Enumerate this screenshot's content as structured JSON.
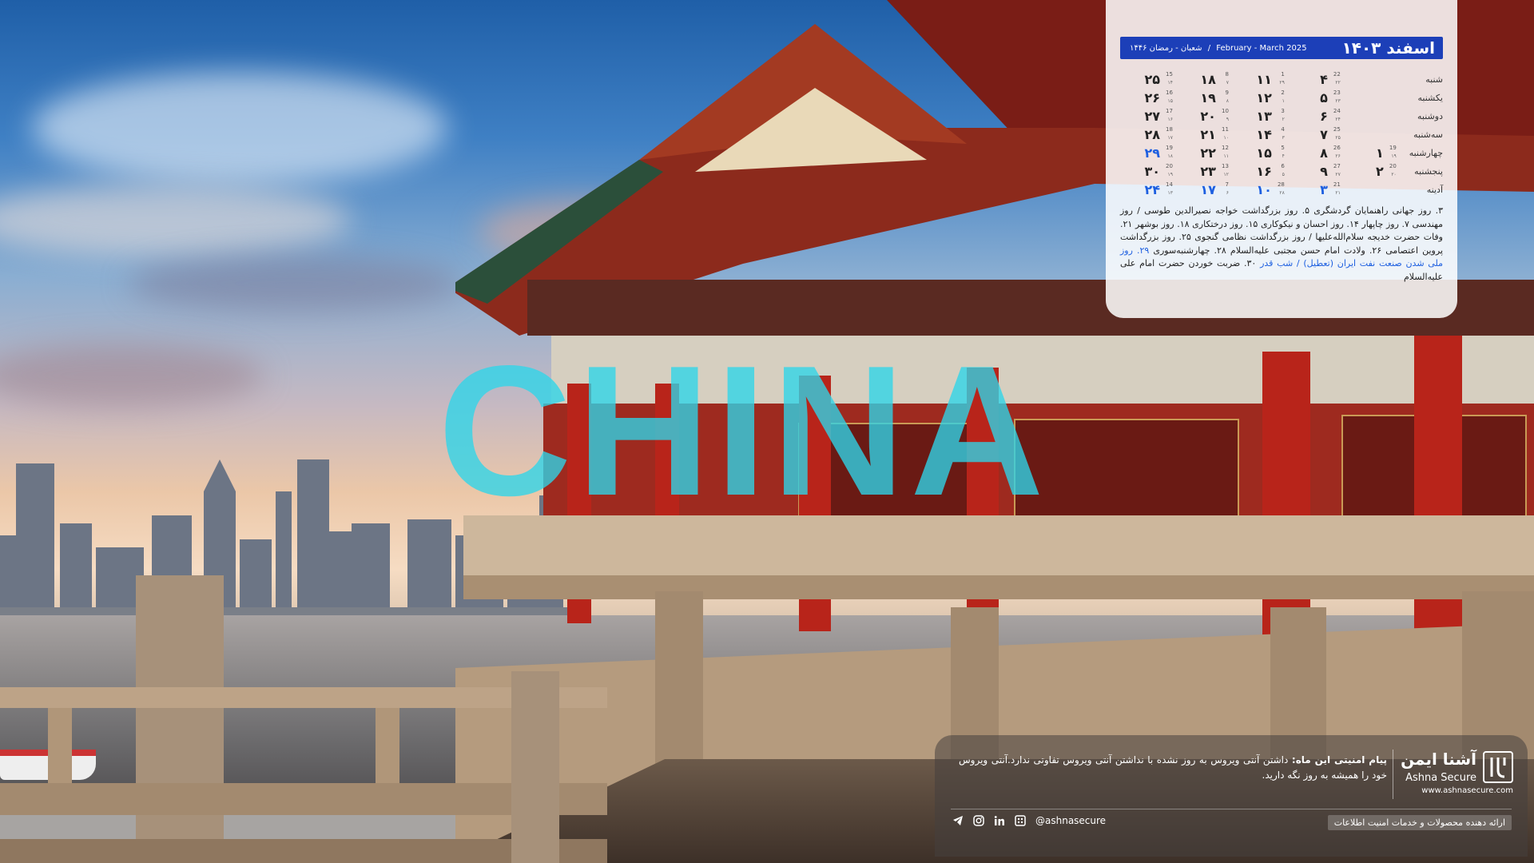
{
  "watermark": "CHINA",
  "calendar": {
    "title": "اسفند ۱۴۰۳",
    "gregorian": "February - March 2025",
    "hijri": "شعبان - رمضان ۱۴۴۶",
    "separator": "/",
    "weekdays": [
      "شنبه",
      "یکشنبه",
      "دوشنبه",
      "سه‌شنبه",
      "چهارشنبه",
      "پنجشنبه",
      "آدینه"
    ],
    "rows": [
      [
        {
          "d": "۴",
          "g": "22",
          "h": "۲۲"
        },
        {
          "d": "۱۱",
          "g": "1",
          "h": "۲۹"
        },
        {
          "d": "۱۸",
          "g": "8",
          "h": "۷"
        },
        {
          "d": "۲۵",
          "g": "15",
          "h": "۱۴"
        }
      ],
      [
        {
          "d": "۵",
          "g": "23",
          "h": "۲۳"
        },
        {
          "d": "۱۲",
          "g": "2",
          "h": "۱"
        },
        {
          "d": "۱۹",
          "g": "9",
          "h": "۸"
        },
        {
          "d": "۲۶",
          "g": "16",
          "h": "۱۵"
        }
      ],
      [
        {
          "d": "۶",
          "g": "24",
          "h": "۲۴"
        },
        {
          "d": "۱۳",
          "g": "3",
          "h": "۲"
        },
        {
          "d": "۲۰",
          "g": "10",
          "h": "۹"
        },
        {
          "d": "۲۷",
          "g": "17",
          "h": "۱۶"
        }
      ],
      [
        {
          "d": "۷",
          "g": "25",
          "h": "۲۵"
        },
        {
          "d": "۱۴",
          "g": "4",
          "h": "۳"
        },
        {
          "d": "۲۱",
          "g": "11",
          "h": "۱۰"
        },
        {
          "d": "۲۸",
          "g": "18",
          "h": "۱۷"
        }
      ],
      [
        {
          "d": "۱",
          "g": "19",
          "h": "۱۹"
        },
        {
          "d": "۸",
          "g": "26",
          "h": "۲۶"
        },
        {
          "d": "۱۵",
          "g": "5",
          "h": "۴"
        },
        {
          "d": "۲۲",
          "g": "12",
          "h": "۱۱"
        },
        {
          "d": "۲۹",
          "g": "19",
          "h": "۱۸",
          "hol": true
        }
      ],
      [
        {
          "d": "۲",
          "g": "20",
          "h": "۲۰"
        },
        {
          "d": "۹",
          "g": "27",
          "h": "۲۷"
        },
        {
          "d": "۱۶",
          "g": "6",
          "h": "۵"
        },
        {
          "d": "۲۳",
          "g": "13",
          "h": "۱۲"
        },
        {
          "d": "۳۰",
          "g": "20",
          "h": "۱۹"
        }
      ],
      [
        {
          "d": "۳",
          "g": "21",
          "h": "۲۱",
          "hol": true
        },
        {
          "d": "۱۰",
          "g": "28",
          "h": "۲۸",
          "hol": true
        },
        {
          "d": "۱۷",
          "g": "7",
          "h": "۶",
          "hol": true
        },
        {
          "d": "۲۴",
          "g": "14",
          "h": "۱۳",
          "hol": true
        }
      ]
    ],
    "events_text": "۳. روز جهانی راهنمایان گردشگری ۵. روز بزرگداشت خواجه نصیرالدین طوسی / روز مهندسی ۷. روز چاپهار ۱۴. روز احسان و نیکوکاری ۱۵. روز درختکاری ۱۸. روز بوشهر ۲۱. وفات حضرت خدیجه سلام‌الله‌علیها / روز بزرگداشت نظامی گنجوی ۲۵. روز بزرگداشت پروین اعتصامی ۲۶. ولادت امام حسن مجتبی علیه‌السلام ۲۸. چهارشنبه‌سوری",
    "events_blue": "۲۹. روز ملی شدن صنعت نفت ایران (تعطیل) / شب قدر",
    "events_tail": "۳۰. ضربت خوردن حضرت امام علی علیه‌السلام"
  },
  "panel": {
    "brand_fa": "آشنا ایمن",
    "brand_en": "Ashna Secure",
    "brand_url": "www.ashnasecure.com",
    "message_title": "پیام امنیتی این ماه:",
    "message_body": "داشتن آنتی ویروس به روز نشده با نداشتن آنتی ویروس تفاوتی ندارد.آنتی ویروس خود را همیشه به روز نگه دارید.",
    "tagline": "ارائه دهنده محصولات و خدمات امنیت اطلاعات",
    "handle": "@ashnasecure"
  }
}
